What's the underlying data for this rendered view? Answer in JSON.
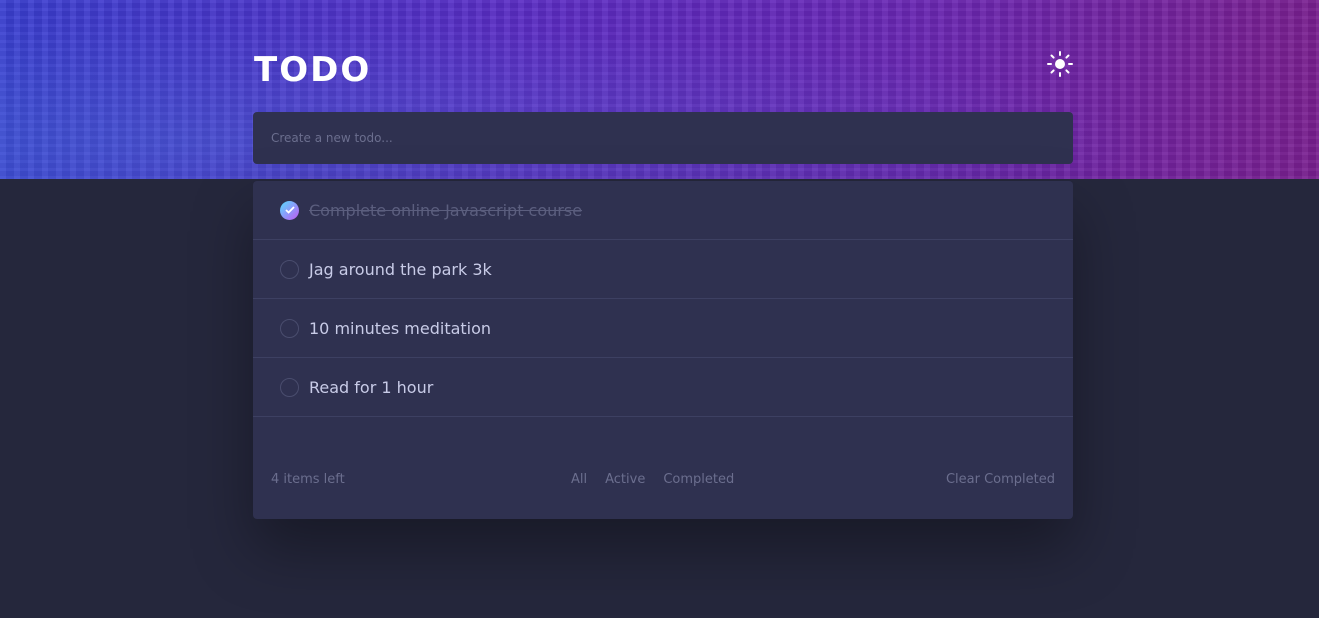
{
  "app": {
    "title": "TODO"
  },
  "new_todo": {
    "placeholder": "Create a new todo..."
  },
  "todos": [
    {
      "text": "Complete online Javascript course",
      "completed": true
    },
    {
      "text": "Jag around the park 3k",
      "completed": false
    },
    {
      "text": "10 minutes meditation",
      "completed": false
    },
    {
      "text": "Read for 1 hour",
      "completed": false
    }
  ],
  "footer": {
    "items_left": "4 items left",
    "filters": [
      "All",
      "Active",
      "Completed"
    ],
    "clear_label": "Clear Completed"
  },
  "theme": {
    "toggle_icon": "sun-icon",
    "accent_start": "#57ddff",
    "accent_end": "#c058f3",
    "background": "#25273c",
    "card": "#2f3150"
  }
}
